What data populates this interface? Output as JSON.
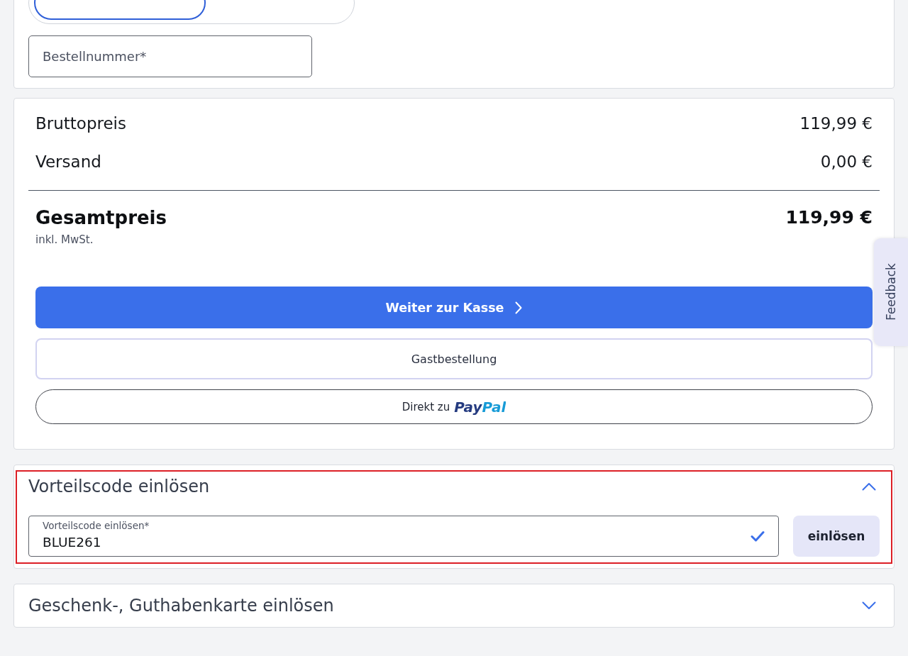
{
  "delivery_toggle": {
    "options": [
      {
        "selected": true
      },
      {
        "selected": false
      }
    ]
  },
  "order_number_field": {
    "placeholder": "Bestellnummer*"
  },
  "summary": {
    "lines": [
      {
        "label": "Bruttopreis",
        "amount": "119,99 €"
      },
      {
        "label": "Versand",
        "amount": "0,00 €"
      }
    ],
    "total": {
      "label": "Gesamtpreis",
      "amount": "119,99 €",
      "note": "inkl. MwSt."
    }
  },
  "actions": [
    {
      "kind": "primary",
      "label": "Weiter zur Kasse"
    },
    {
      "kind": "secondary",
      "label": "Gastbestellung"
    },
    {
      "kind": "paypal",
      "label": "Direkt zu",
      "logo": "PayPal"
    }
  ],
  "sections": [
    {
      "title": "Vorteilscode einlösen",
      "expanded": true,
      "highlighted": true,
      "field": {
        "label": "Vorteilscode einlösen*",
        "value": "BLUE261",
        "valid": true
      },
      "button": "einlösen"
    },
    {
      "title": "Geschenk-, Guthabenkarte einlösen",
      "expanded": false,
      "highlighted": false
    }
  ],
  "feedback_tab": {
    "label": "Feedback"
  }
}
